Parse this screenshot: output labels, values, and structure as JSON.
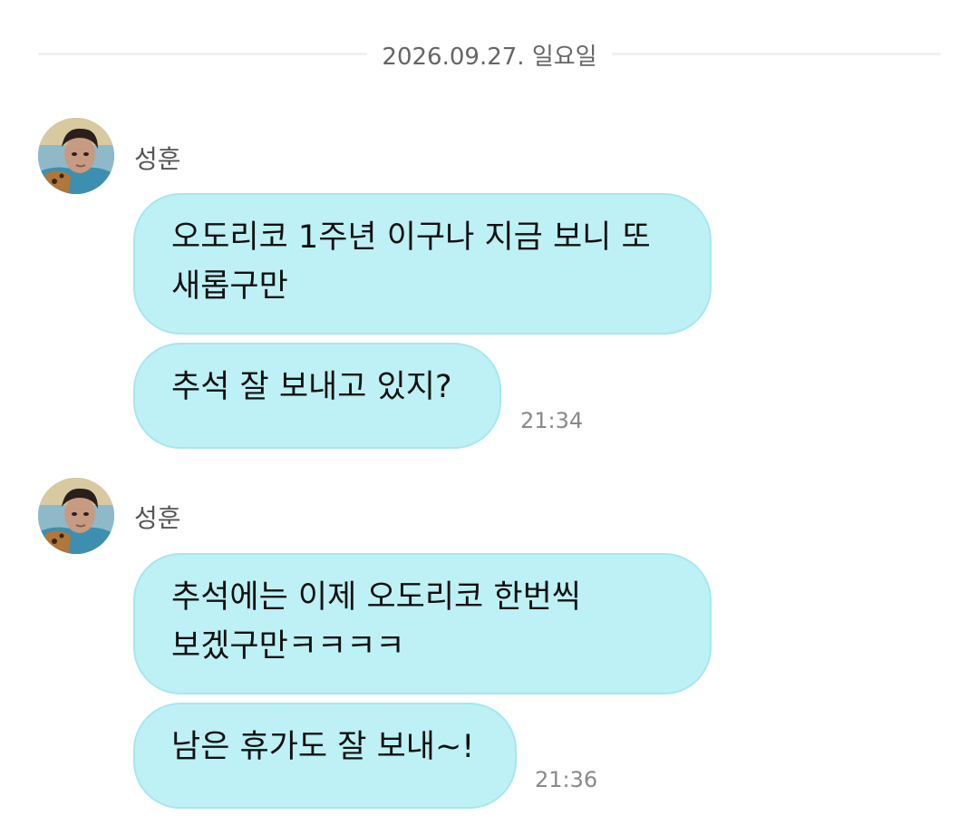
{
  "date_divider": "2026.09.27. 일요일",
  "colors": {
    "bubble": "#bdf1f5",
    "bubble_border": "#a7e7ee",
    "divider_line": "#f1f1f1",
    "date_text": "#666666",
    "time_text": "#8a8a8a"
  },
  "groups": [
    {
      "sender": "성훈",
      "avatar_icon": "profile-photo",
      "messages": [
        {
          "text": "오도리코 1주년 이구나 지금 보니 또\n새롭구만"
        },
        {
          "text": "추석 잘 보내고 있지?",
          "time": "21:34"
        }
      ]
    },
    {
      "sender": "성훈",
      "avatar_icon": "profile-photo",
      "messages": [
        {
          "text": "추석에는 이제 오도리코 한번씩\n보겠구만ㅋㅋㅋㅋ"
        },
        {
          "text": "남은 휴가도 잘 보내~!",
          "time": "21:36"
        }
      ]
    }
  ]
}
